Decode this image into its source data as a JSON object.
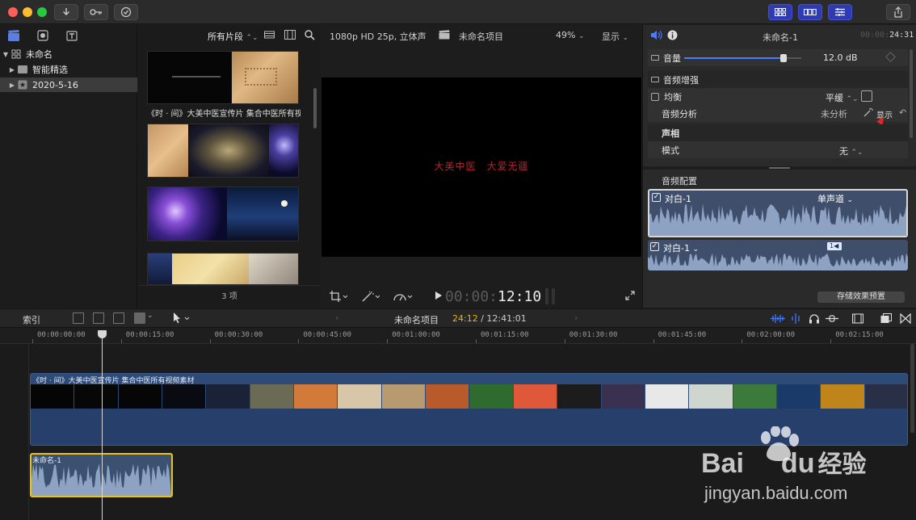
{
  "titlebar": {
    "icons": [
      "import-icon",
      "key-icon",
      "check-icon"
    ],
    "right_icons": [
      "libraries-toggle",
      "timeline-toggle",
      "inspector-toggle",
      "share-icon"
    ]
  },
  "library": {
    "top_icons": [
      "clapper-icon",
      "photos-icon",
      "titles-icon"
    ],
    "items": [
      {
        "label": "未命名",
        "expanded": true
      },
      {
        "label": "智能精选",
        "expanded": false
      },
      {
        "label": "2020-5-16",
        "expanded": false,
        "selected": true
      }
    ]
  },
  "browser": {
    "filter_label": "所有片段",
    "clip_title": "《时 · 间》大美中医宣传片 集合中医所有视",
    "item_count": "3 项"
  },
  "viewer": {
    "format": "1080p HD 25p, 立体声",
    "project_name": "未命名项目",
    "zoom": "49%",
    "display_label": "显示",
    "overlay_text": "大美中医　大爱无疆",
    "timecode_dim": "00:00:",
    "timecode": "12:10"
  },
  "inspector": {
    "clip_name": "未命名-1",
    "duration_dim": "00:00:",
    "duration": "24:31",
    "volume_label": "音量",
    "volume_value": "12.0 dB",
    "volume_level": 0.85,
    "enhance_section": "音频增强",
    "eq_label": "均衡",
    "eq_value": "平缓",
    "analysis_label": "音频分析",
    "analysis_value": "未分析",
    "show_label": "显示",
    "tooltip_label": "显示",
    "pan_section": "声相",
    "mode_label": "模式",
    "mode_value": "无",
    "config_section": "音频配置",
    "channel1_name": "对白-1",
    "channel1_mode": "单声道",
    "channel2_name": "对白-1",
    "channel2_badge": "1",
    "save_preset": "存储效果预置"
  },
  "timeline": {
    "index_label": "索引",
    "project_name": "未命名项目",
    "current_time": "24:12",
    "total_time": "/ 12:41:01",
    "ruler_labels": [
      "00:00:00:00",
      "00:00:15:00",
      "00:00:30:00",
      "00:00:45:00",
      "00:01:00:00",
      "00:01:15:00",
      "00:01:30:00",
      "00:01:45:00",
      "00:02:00:00",
      "00:02:15:00"
    ],
    "video_clip_title": "《时 · 间》大美中医宣传片 集合中医所有视频素材",
    "audio_clip_title": "未命名-1"
  },
  "watermark": {
    "brand_a": "Bai",
    "brand_b": "du",
    "brand_cn": "经验",
    "url": "jingyan.baidu.com"
  },
  "colors": {
    "accent_blue": "#2f3bb3",
    "clip_blue": "#2e4a77",
    "audio_yellow": "#e8c21d",
    "overlay_red": "#c0202a"
  }
}
